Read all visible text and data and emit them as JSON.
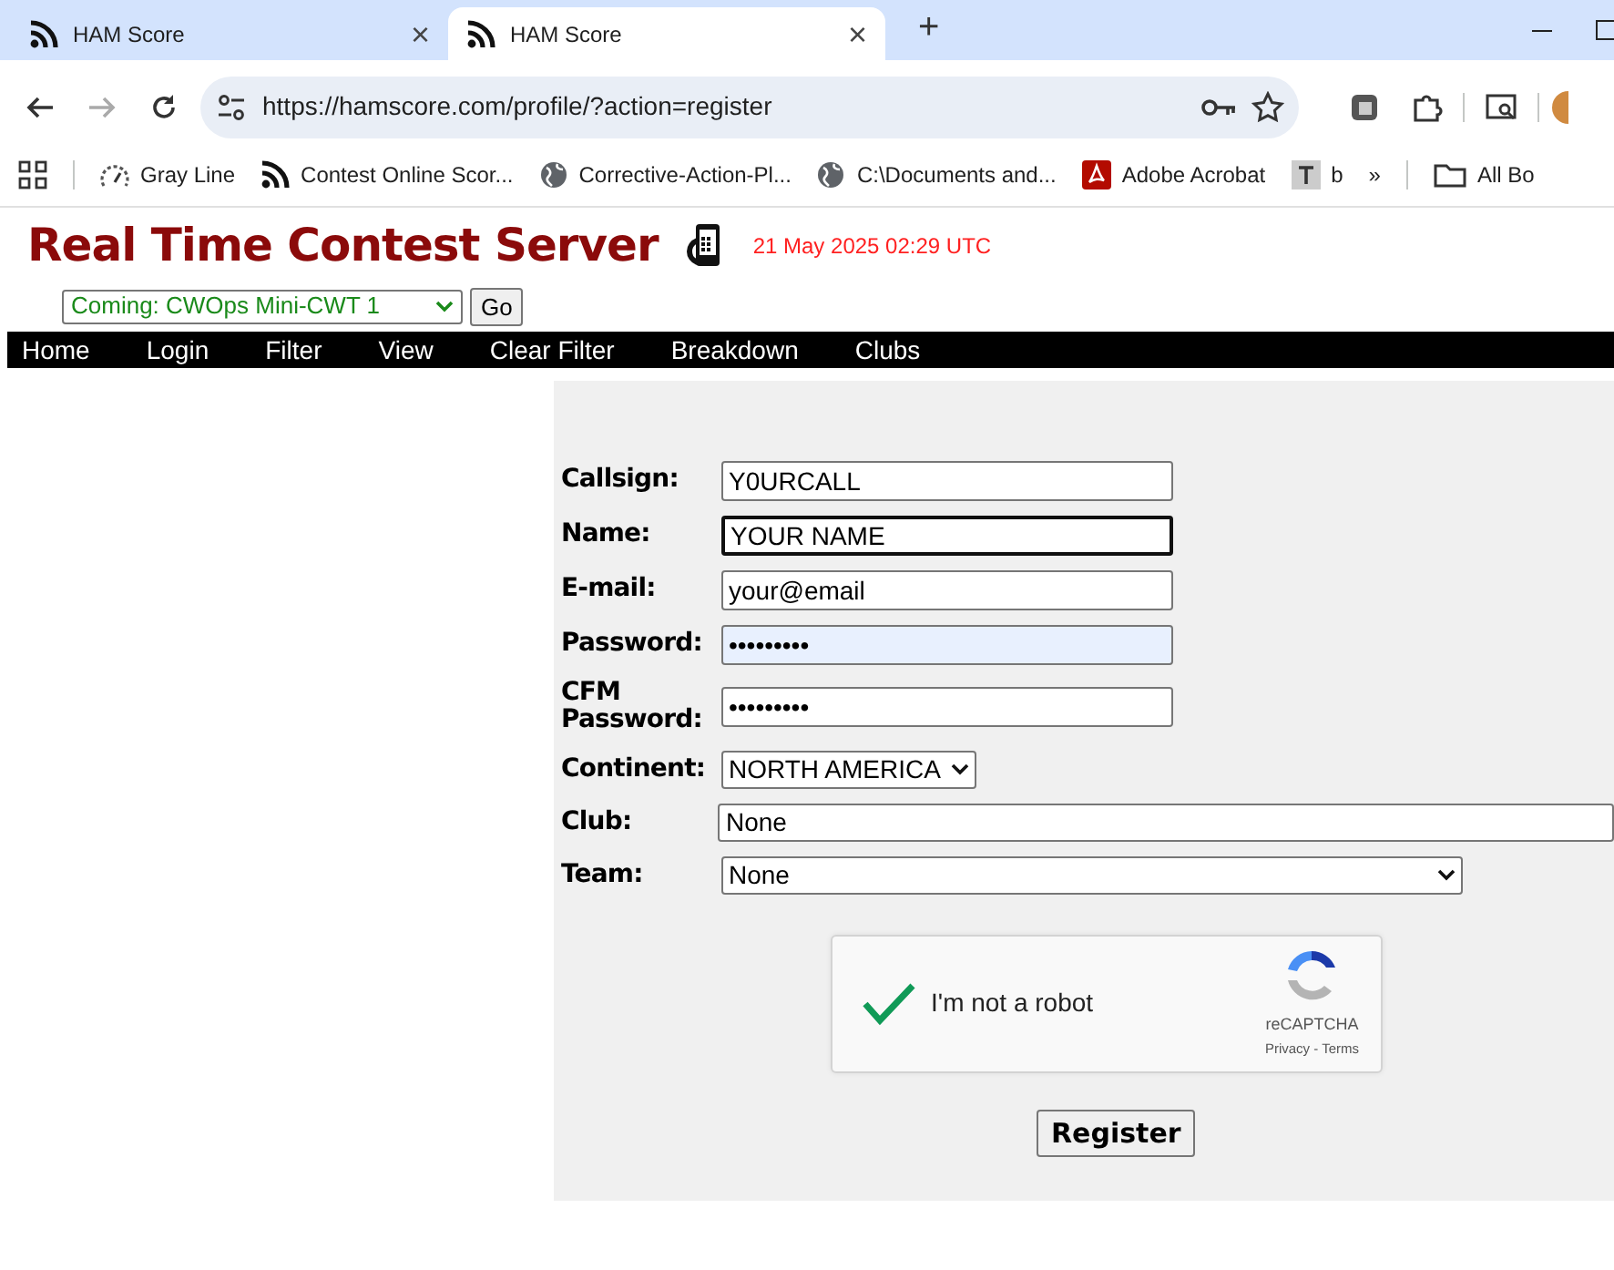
{
  "browser": {
    "tabs": [
      {
        "title": "HAM Score",
        "selected": false,
        "close": "×"
      },
      {
        "title": "HAM Score",
        "selected": true,
        "close": "×"
      }
    ],
    "new_tab": "+",
    "address": "https://hamscore.com/profile/?action=register",
    "bookmarks": [
      {
        "kind": "gauge",
        "label": "Gray Line"
      },
      {
        "kind": "rss",
        "label": "Contest Online Scor..."
      },
      {
        "kind": "globe",
        "label": "Corrective-Action-Pl..."
      },
      {
        "kind": "globe",
        "label": "C:\\Documents and..."
      },
      {
        "kind": "pdf",
        "label": "Adobe Acrobat"
      },
      {
        "kind": "tee",
        "label": "b"
      }
    ],
    "more": "»",
    "all_bookmarks": "All Bo"
  },
  "header": {
    "title": "Real Time Contest Server",
    "date": "21 May 2025 02:29 UTC",
    "contest_select": "Coming: CWOps Mini-CWT 1",
    "go": "Go"
  },
  "nav": [
    "Home",
    "Login",
    "Filter",
    "View",
    "Clear Filter",
    "Breakdown",
    "Clubs"
  ],
  "form": {
    "fields": [
      {
        "label": "Callsign:",
        "kind": "input",
        "value": "Y0URCALL",
        "focused": false,
        "autofilled": false
      },
      {
        "label": "Name:",
        "kind": "input",
        "value": "YOUR NAME",
        "focused": true,
        "autofilled": false
      },
      {
        "label": "E-mail:",
        "kind": "input",
        "value": "your@email",
        "focused": false,
        "autofilled": false
      },
      {
        "label": "Password:",
        "kind": "input",
        "value": "•••••••••",
        "focused": false,
        "autofilled": true
      },
      {
        "label": "CFM Password:",
        "kind": "input",
        "value": "•••••••••",
        "focused": false,
        "autofilled": false
      },
      {
        "label": "Continent:",
        "kind": "select",
        "value": "NORTH AMERICA"
      },
      {
        "label": "Club:",
        "kind": "cutselect",
        "value": "None"
      },
      {
        "label": "Team:",
        "kind": "wideselect",
        "value": "None"
      }
    ],
    "captcha": {
      "checked": true,
      "label": "I'm not a robot",
      "brand": "reCAPTCHA",
      "links": "Privacy - Terms"
    },
    "submit": "Register"
  }
}
